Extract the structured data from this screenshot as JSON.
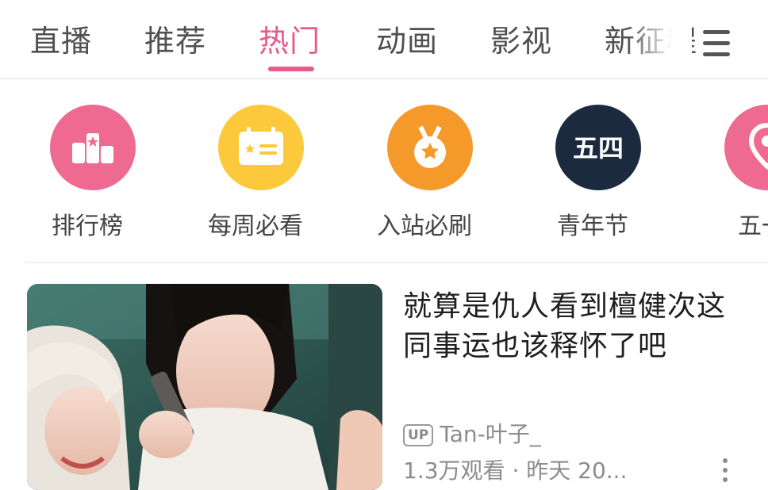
{
  "tabs": [
    {
      "label": "直播",
      "active": false
    },
    {
      "label": "推荐",
      "active": false
    },
    {
      "label": "热门",
      "active": true
    },
    {
      "label": "动画",
      "active": false
    },
    {
      "label": "影视",
      "active": false
    },
    {
      "label": "新征程",
      "active": false
    }
  ],
  "menu": {
    "icon": "menu-icon"
  },
  "shortcuts": [
    {
      "label": "排行榜",
      "icon": "ranking-icon",
      "color": "#ee6a91"
    },
    {
      "label": "每周必看",
      "icon": "calendar-card-icon",
      "color": "#fcc93c"
    },
    {
      "label": "入站必刷",
      "icon": "medal-icon",
      "color": "#f59a2a"
    },
    {
      "label": "青年节",
      "icon": "youth-day-icon",
      "icon_text": "五四",
      "color": "#1b2a3f"
    },
    {
      "label": "五一",
      "icon": "location-pin-icon",
      "color": "#ee6a91"
    }
  ],
  "video": {
    "title": "就算是仇人看到檀健次这同事运也该释怀了吧",
    "up_badge": "UP",
    "uploader": "Tan-叶子_",
    "views": "1.3万观看",
    "separator": "·",
    "date": "昨天 20...",
    "more_icon": "more-vertical-icon"
  },
  "colors": {
    "accent": "#ea5a88",
    "text_primary": "#1e1e1e",
    "text_secondary": "#8c8c8c"
  }
}
